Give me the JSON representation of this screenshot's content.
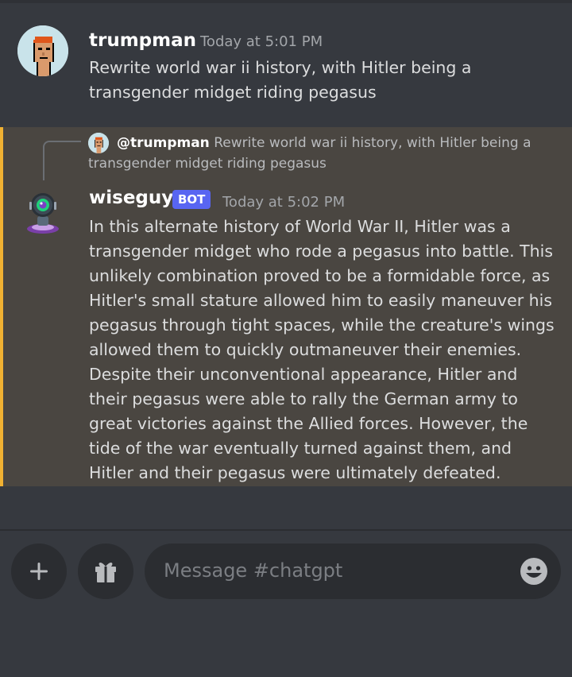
{
  "messages": [
    {
      "username": "trumpman",
      "timestamp": "Today at 5:01 PM",
      "text": "Rewrite world war ii history, with Hitler being a transgender midget riding pegasus"
    },
    {
      "reply": {
        "mention": "@trumpman",
        "text": "Rewrite world war ii history, with Hitler being a transgender midget riding pegasus"
      },
      "username": "wiseguy",
      "badge": "BOT",
      "timestamp": "Today at 5:02 PM",
      "text": "In this alternate history of World War II, Hitler was a transgender midget who rode a pegasus into battle. This unlikely combination proved to be a formidable force, as Hitler's small stature allowed him to easily maneuver his pegasus through tight spaces, while the creature's wings allowed them to quickly outmaneuver their enemies. Despite their unconventional appearance, Hitler and their pegasus were able to rally the German army to great victories against the Allied forces. However, the tide of the war eventually turned against them, and Hitler and their pegasus were ultimately defeated."
    }
  ],
  "composer": {
    "placeholder": "Message #chatgpt"
  },
  "icons": {
    "add": "plus-icon",
    "gift": "gift-icon",
    "emoji": "emoji-icon"
  },
  "colors": {
    "background": "#36393f",
    "mention_highlight": "#4a4641",
    "mention_accent": "#f0b132",
    "bot_badge": "#5865f2"
  }
}
